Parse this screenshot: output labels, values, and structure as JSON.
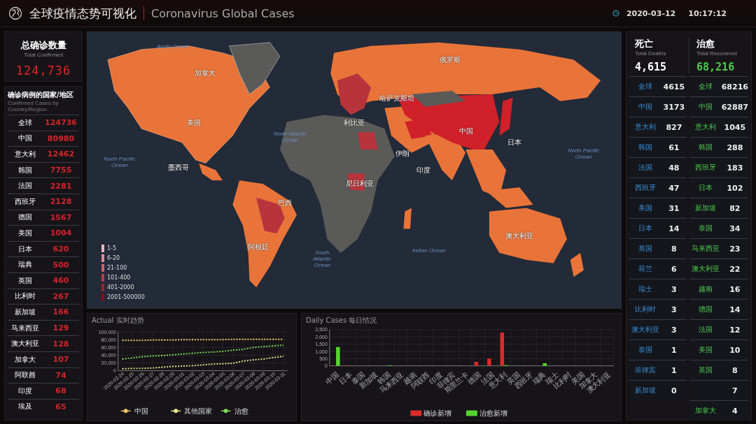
{
  "header": {
    "title": "全球疫情态势可视化",
    "subtitle": "Coronavirus Global Cases",
    "date": "2020-03-12",
    "time": "10:17:12"
  },
  "total_confirmed": {
    "label": "总确诊数量",
    "sublabel": "Total Confirmed",
    "value": "124,736"
  },
  "confirmed_list": {
    "title": "确诊病例的国家/地区",
    "subtitle": "Confirmed Cases by Country/Region",
    "rows": [
      {
        "name": "全球",
        "value": "124736"
      },
      {
        "name": "中国",
        "value": "80980"
      },
      {
        "name": "意大利",
        "value": "12462"
      },
      {
        "name": "韩国",
        "value": "7755"
      },
      {
        "name": "法国",
        "value": "2281"
      },
      {
        "name": "西班牙",
        "value": "2128"
      },
      {
        "name": "德国",
        "value": "1567"
      },
      {
        "name": "美国",
        "value": "1004"
      },
      {
        "name": "日本",
        "value": "620"
      },
      {
        "name": "瑞典",
        "value": "500"
      },
      {
        "name": "英国",
        "value": "460"
      },
      {
        "name": "比利时",
        "value": "267"
      },
      {
        "name": "新加坡",
        "value": "166"
      },
      {
        "name": "马来西亚",
        "value": "129"
      },
      {
        "name": "澳大利亚",
        "value": "128"
      },
      {
        "name": "加拿大",
        "value": "107"
      },
      {
        "name": "阿联酋",
        "value": "74"
      },
      {
        "name": "印度",
        "value": "68"
      },
      {
        "name": "埃及",
        "value": "65"
      }
    ]
  },
  "map": {
    "oceans": [
      "Arctic Ocean",
      "North Atlantic Ocean",
      "North Pacific Ocean",
      "South Atlantic Ocean",
      "Indian Ocean",
      "North Pacific Ocean"
    ],
    "countries": [
      "加拿大",
      "美国",
      "墨西哥",
      "巴西",
      "阿根廷",
      "俄罗斯",
      "哈萨克斯坦",
      "中国",
      "日本",
      "印度",
      "伊朗",
      "利比亚",
      "尼日利亚",
      "澳大利亚"
    ],
    "legend": [
      {
        "label": "1-5",
        "color": "#f2b6bc"
      },
      {
        "label": "6-20",
        "color": "#e58a94"
      },
      {
        "label": "21-100",
        "color": "#d0606e"
      },
      {
        "label": "101-400",
        "color": "#b93a4a"
      },
      {
        "label": "401-2000",
        "color": "#a11f2c"
      },
      {
        "label": "2001-500000",
        "color": "#8a0c14"
      }
    ]
  },
  "deaths": {
    "label": "死亡",
    "sublabel": "Total Deaths",
    "value": "4,615",
    "rows": [
      {
        "name": "全球",
        "value": "4615"
      },
      {
        "name": "中国",
        "value": "3173"
      },
      {
        "name": "意大利",
        "value": "827"
      },
      {
        "name": "韩国",
        "value": "61"
      },
      {
        "name": "法国",
        "value": "48"
      },
      {
        "name": "西班牙",
        "value": "47"
      },
      {
        "name": "美国",
        "value": "31"
      },
      {
        "name": "日本",
        "value": "14"
      },
      {
        "name": "英国",
        "value": "8"
      },
      {
        "name": "荷兰",
        "value": "6"
      },
      {
        "name": "瑞士",
        "value": "3"
      },
      {
        "name": "比利时",
        "value": "3"
      },
      {
        "name": "澳大利亚",
        "value": "3"
      },
      {
        "name": "泰国",
        "value": "1"
      },
      {
        "name": "菲律宾",
        "value": "1"
      },
      {
        "name": "新加坡",
        "value": "0"
      }
    ]
  },
  "recovered": {
    "label": "治愈",
    "sublabel": "Total Recovered",
    "value": "68,216",
    "rows": [
      {
        "name": "全球",
        "value": "68216"
      },
      {
        "name": "中国",
        "value": "62887"
      },
      {
        "name": "意大利",
        "value": "1045"
      },
      {
        "name": "韩国",
        "value": "288"
      },
      {
        "name": "西班牙",
        "value": "183"
      },
      {
        "name": "日本",
        "value": "102"
      },
      {
        "name": "新加坡",
        "value": "82"
      },
      {
        "name": "泰国",
        "value": "34"
      },
      {
        "name": "马来西亚",
        "value": "23"
      },
      {
        "name": "澳大利亚",
        "value": "22"
      },
      {
        "name": "越南",
        "value": "16"
      },
      {
        "name": "德国",
        "value": "14"
      },
      {
        "name": "法国",
        "value": "12"
      },
      {
        "name": "美国",
        "value": "10"
      },
      {
        "name": "英国",
        "value": "8"
      },
      {
        "value": "7"
      },
      {
        "name": "加拿大",
        "value": "4"
      }
    ]
  },
  "actual_trend": {
    "title": "Actual 实时趋势",
    "chart_data": {
      "type": "line",
      "grid": true,
      "legend": true,
      "categories": [
        "2020-02-24",
        "2020-02-25",
        "2020-02-26",
        "2020-02-27",
        "2020-02-28",
        "2020-02-29",
        "2020-03-01",
        "2020-03-02",
        "2020-03-03",
        "2020-03-04",
        "2020-03-05",
        "2020-03-06",
        "2020-03-07",
        "2020-03-08",
        "2020-03-09",
        "2020-03-10",
        "2020-03-11"
      ],
      "ylim": [
        0,
        100000
      ],
      "yticks": [
        {
          "value": 0,
          "label": "0"
        },
        {
          "value": 20000,
          "label": "20,000"
        },
        {
          "value": 40000,
          "label": "40,000"
        },
        {
          "value": 60000,
          "label": "60,000"
        },
        {
          "value": 80000,
          "label": "80,000"
        },
        {
          "value": 100000,
          "label": "100,000"
        }
      ],
      "series": [
        {
          "name": "中国",
          "color": "#f3c26b",
          "line_style": "dotted",
          "values": [
            78000,
            78000,
            78000,
            79000,
            79000,
            79000,
            80000,
            80000,
            80000,
            80000,
            80000,
            81000,
            81000,
            81000,
            81000,
            81000,
            81000
          ]
        },
        {
          "name": "其他国家",
          "color": "#e6e889",
          "line_style": "dotted",
          "values": [
            5000,
            6000,
            6000,
            7000,
            9000,
            11000,
            12000,
            13000,
            15000,
            17000,
            18000,
            19000,
            25000,
            28000,
            30000,
            34000,
            37000
          ]
        },
        {
          "name": "治愈",
          "color": "#7fd95a",
          "line_style": "dotted",
          "values": [
            30000,
            33000,
            36000,
            38000,
            39000,
            41000,
            43000,
            45000,
            47000,
            48000,
            50000,
            53000,
            55000,
            60000,
            62000,
            64000,
            66000
          ]
        }
      ]
    }
  },
  "daily_cases": {
    "title": "Daily Cases 每日情况",
    "chart_data": {
      "type": "bar",
      "grid": true,
      "legend": true,
      "categories": [
        "中国",
        "日本",
        "泰国",
        "新加坡",
        "韩国",
        "马来西亚",
        "越南",
        "阿联酋",
        "印度",
        "菲律宾",
        "斯里兰卡",
        "德国",
        "法国",
        "意大利",
        "英国",
        "西班牙",
        "瑞典",
        "瑞士",
        "比利时",
        "美国",
        "加拿大",
        "澳大利亚"
      ],
      "ylim": [
        0,
        2500
      ],
      "yticks": [
        {
          "value": 0,
          "label": "0"
        },
        {
          "value": 500,
          "label": "500"
        },
        {
          "value": 1000,
          "label": "1,000"
        },
        {
          "value": 1500,
          "label": "1,500"
        },
        {
          "value": 2000,
          "label": "2,000"
        },
        {
          "value": 2500,
          "label": "2,500"
        }
      ],
      "series": [
        {
          "name": "确诊新增",
          "color": "#d92b2b",
          "values": [
            20,
            30,
            0,
            0,
            0,
            0,
            0,
            0,
            0,
            0,
            0,
            280,
            500,
            2300,
            0,
            0,
            0,
            0,
            0,
            0,
            0,
            0
          ]
        },
        {
          "name": "治愈新增",
          "color": "#55d62f",
          "values": [
            1300,
            0,
            0,
            0,
            40,
            0,
            0,
            0,
            0,
            0,
            0,
            0,
            0,
            50,
            0,
            0,
            180,
            0,
            0,
            0,
            0,
            0
          ]
        }
      ]
    }
  }
}
